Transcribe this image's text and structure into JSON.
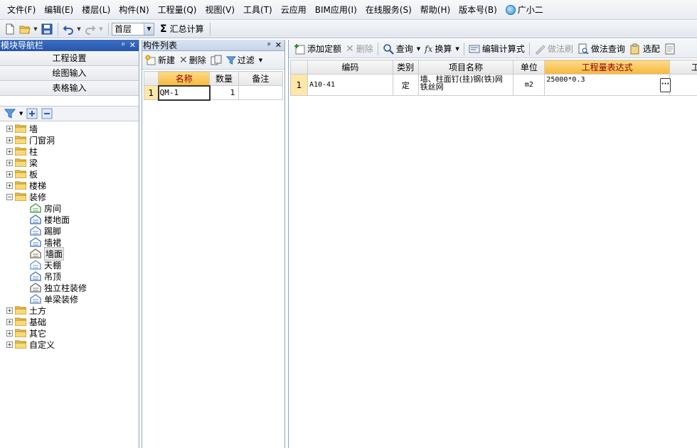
{
  "menu": [
    "文件(F)",
    "编辑(E)",
    "楼层(L)",
    "构件(N)",
    "工程量(Q)",
    "视图(V)",
    "工具(T)",
    "云应用",
    "BIM应用(I)",
    "在线服务(S)",
    "帮助(H)",
    "版本号(B)"
  ],
  "assistant_label": "广小二",
  "toolbar": {
    "floor": "首层",
    "sum_label": "汇总计算"
  },
  "nav": {
    "title": "模块导航栏",
    "tabs": [
      "工程设置",
      "绘图输入",
      "表格输入"
    ],
    "tree": [
      {
        "label": "墙",
        "expanded": false
      },
      {
        "label": "门窗洞",
        "expanded": false
      },
      {
        "label": "柱",
        "expanded": false
      },
      {
        "label": "梁",
        "expanded": false
      },
      {
        "label": "板",
        "expanded": false
      },
      {
        "label": "楼梯",
        "expanded": false
      },
      {
        "label": "装修",
        "expanded": true
      },
      {
        "label": "土方",
        "expanded": false
      },
      {
        "label": "基础",
        "expanded": false
      },
      {
        "label": "其它",
        "expanded": false
      },
      {
        "label": "自定义",
        "expanded": false
      }
    ],
    "decoration_children": [
      "房间",
      "楼地面",
      "踢脚",
      "墙裙",
      "墙面",
      "天棚",
      "吊顶",
      "独立柱装修",
      "单梁装修"
    ],
    "selected_child": "墙面"
  },
  "component_list": {
    "title": "构件列表",
    "toolbar": {
      "new": "新建",
      "delete": "删除",
      "filter": "过滤"
    },
    "columns": [
      "名称",
      "数量",
      "备注"
    ],
    "rows": [
      {
        "num": "1",
        "name": "QM-1",
        "qty": "1",
        "note": ""
      }
    ]
  },
  "right": {
    "toolbar": {
      "add_quota": "添加定额",
      "delete": "删除",
      "query": "查询",
      "convert": "换算",
      "edit_formula": "编辑计算式",
      "method_brush": "做法刷",
      "method_query": "做法查询",
      "select": "选配"
    },
    "columns": [
      "编码",
      "类别",
      "项目名称",
      "单位",
      "工程量表达式",
      "工"
    ],
    "rows": [
      {
        "num": "1",
        "code": "A10-41",
        "type": "定",
        "name": "墙、柱面钉(挂)钢(铁)网 铁丝网",
        "unit": "m2",
        "expr": "25000*0.3"
      }
    ]
  }
}
